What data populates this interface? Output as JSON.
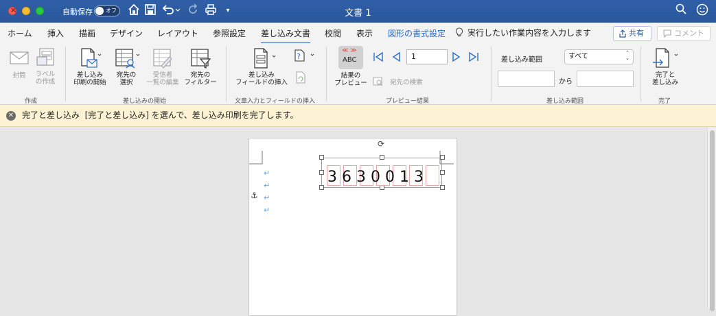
{
  "titlebar": {
    "autosave_label": "自動保存",
    "autosave_state": "オフ",
    "document_title": "文書 1"
  },
  "tabs": {
    "home": "ホーム",
    "insert": "挿入",
    "draw": "描画",
    "design": "デザイン",
    "layout": "レイアウト",
    "references": "参照設定",
    "mailings": "差し込み文書",
    "review": "校閲",
    "view": "表示",
    "shape_format": "図形の書式設定",
    "tell_me": "実行したい作業内容を入力します",
    "share": "共有",
    "comment": "コメント"
  },
  "ribbon": {
    "create": {
      "title": "作成",
      "envelopes": "封筒",
      "labels_1": "ラベル",
      "labels_2": "の作成"
    },
    "start_merge": {
      "title": "差し込みの開始",
      "start_1": "差し込み",
      "start_2": "印刷の開始",
      "select_1": "宛先の",
      "select_2": "選択",
      "edit_1": "受信者",
      "edit_2": "一覧の編集",
      "filter_1": "宛先の",
      "filter_2": "フィルター"
    },
    "write_insert": {
      "title": "文章入力とフィールドの挿入",
      "insert_1": "差し込み",
      "insert_2": "フィールドの挿入"
    },
    "preview": {
      "title": "プレビュー結果",
      "preview_1": "結果の",
      "preview_2": "プレビュー",
      "abc": "ABC",
      "find": "宛先の検索",
      "record": "1"
    },
    "merge_range": {
      "title": "差し込み範囲",
      "label": "差し込み範囲",
      "select_value": "すべて",
      "from": "から"
    },
    "finish": {
      "title": "完了",
      "finish_1": "完了と",
      "finish_2": "差し込み"
    }
  },
  "message_bar": {
    "text": "完了と差し込み  [完了と差し込み] を選んで、差し込み印刷を完了します。"
  },
  "document": {
    "postal_code": "3630013"
  },
  "colors": {
    "title_bar": "#2b579a",
    "accent": "#2b6cc4",
    "message_bar": "#fdf3d4"
  }
}
